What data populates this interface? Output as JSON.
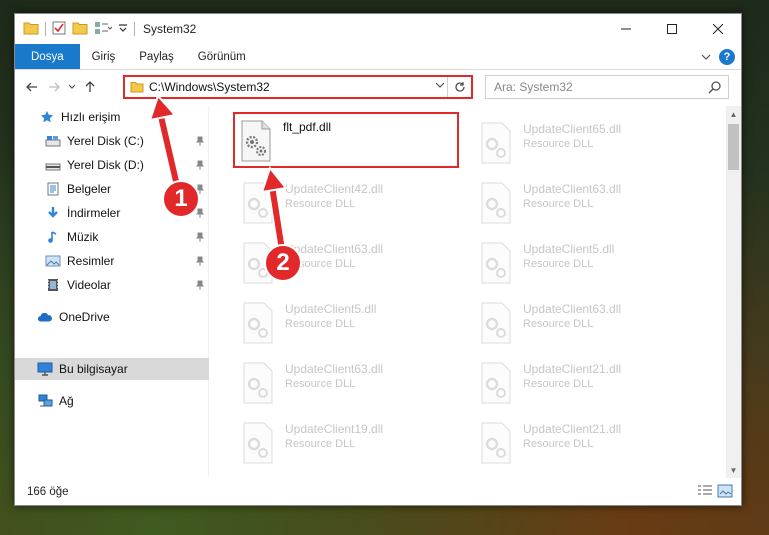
{
  "window": {
    "title": "System32"
  },
  "ribbon": {
    "tabs": [
      {
        "label": "Dosya",
        "active": true
      },
      {
        "label": "Giriş",
        "active": false
      },
      {
        "label": "Paylaş",
        "active": false
      },
      {
        "label": "Görünüm",
        "active": false
      }
    ],
    "help_label": "?"
  },
  "navigation": {
    "address": "C:\\Windows\\System32",
    "search_placeholder": "Ara: System32"
  },
  "sidebar": {
    "items": [
      {
        "label": "Hızlı erişim",
        "icon": "star-icon",
        "pinned": false
      },
      {
        "label": "Yerel Disk (C:)",
        "icon": "drive-icon",
        "pinned": true
      },
      {
        "label": "Yerel Disk (D:)",
        "icon": "drive-icon",
        "pinned": true
      },
      {
        "label": "Belgeler",
        "icon": "documents-icon",
        "pinned": true
      },
      {
        "label": "İndirmeler",
        "icon": "download-icon",
        "pinned": true
      },
      {
        "label": "Müzik",
        "icon": "music-icon",
        "pinned": true
      },
      {
        "label": "Resimler",
        "icon": "pictures-icon",
        "pinned": true
      },
      {
        "label": "Videolar",
        "icon": "video-icon",
        "pinned": true
      },
      {
        "label": "OneDrive",
        "icon": "cloud-icon",
        "pinned": false
      },
      {
        "label": "Bu bilgisayar",
        "icon": "computer-icon",
        "pinned": false,
        "selected": true
      },
      {
        "label": "Ağ",
        "icon": "network-icon",
        "pinned": false
      }
    ]
  },
  "files": {
    "left": [
      {
        "name": "flt_pdf.dll",
        "type": "",
        "highlight": true
      },
      {
        "name": "UpdateClient42.dll",
        "type": "Resource DLL"
      },
      {
        "name": "UpdateClient63.dll",
        "type": "Resource DLL"
      },
      {
        "name": "UpdateClient5.dll",
        "type": "Resource DLL"
      },
      {
        "name": "UpdateClient63.dll",
        "type": "Resource DLL"
      },
      {
        "name": "UpdateClient19.dll",
        "type": "Resource DLL"
      }
    ],
    "right": [
      {
        "name": "UpdateClient65.dll",
        "type": "Resource DLL"
      },
      {
        "name": "UpdateClient63.dll",
        "type": "Resource DLL"
      },
      {
        "name": "UpdateClient5.dll",
        "type": "Resource DLL"
      },
      {
        "name": "UpdateClient63.dll",
        "type": "Resource DLL"
      },
      {
        "name": "UpdateClient21.dll",
        "type": "Resource DLL"
      },
      {
        "name": "UpdateClient21.dll",
        "type": "Resource DLL"
      }
    ]
  },
  "status": {
    "item_count": "166 öğe"
  },
  "annotations": [
    {
      "label": "1"
    },
    {
      "label": "2"
    }
  ],
  "colors": {
    "accent": "#1979ca",
    "annotation_red": "#e2292a"
  }
}
